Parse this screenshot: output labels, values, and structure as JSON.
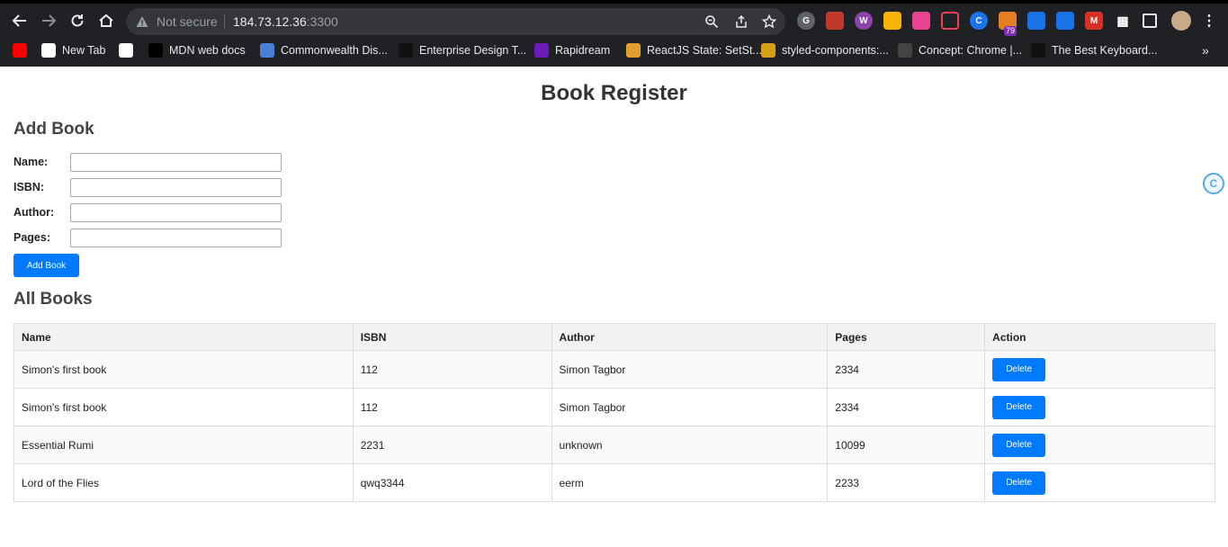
{
  "browser": {
    "security_label": "Not secure",
    "url_host": "184.73.12.36",
    "url_port": ":3300",
    "extension_badge_count": "79",
    "bookmarks": [
      {
        "label": "",
        "icon": "youtube-icon",
        "color": "#ff0000"
      },
      {
        "label": "New Tab",
        "icon": "google-icon",
        "color": "#ffffff"
      },
      {
        "label": "",
        "icon": "globe-icon",
        "color": "#ffffff"
      },
      {
        "label": "MDN web docs",
        "icon": "mdn-icon",
        "color": "#000000"
      },
      {
        "label": "Commonwealth Dis...",
        "icon": "globe-icon",
        "color": "#4a7fd6"
      },
      {
        "label": "Enterprise Design T...",
        "icon": "enterprise-icon",
        "color": "#111111"
      },
      {
        "label": "Rapidream",
        "icon": "rapidream-icon",
        "color": "#6a1bb8"
      },
      {
        "label": "ReactJS State: SetSt...",
        "icon": "react-state-icon",
        "color": "#e0a030"
      },
      {
        "label": "styled-components:...",
        "icon": "styled-components-icon",
        "color": "#d4a017"
      },
      {
        "label": "Concept: Chrome |...",
        "icon": "concept-icon",
        "color": "#444444"
      },
      {
        "label": "The Best Keyboard...",
        "icon": "htg-icon",
        "color": "#111111"
      }
    ]
  },
  "page": {
    "title": "Book Register",
    "add_section_title": "Add Book",
    "list_section_title": "All Books"
  },
  "form": {
    "name_label": "Name:",
    "isbn_label": "ISBN:",
    "author_label": "Author:",
    "pages_label": "Pages:",
    "name_value": "",
    "isbn_value": "",
    "author_value": "",
    "pages_value": "",
    "submit_label": "Add Book"
  },
  "table": {
    "headers": [
      "Name",
      "ISBN",
      "Author",
      "Pages",
      "Action"
    ],
    "delete_label": "Delete",
    "rows": [
      {
        "name": "Simon's first book",
        "isbn": "112",
        "author": "Simon Tagbor",
        "pages": "2334"
      },
      {
        "name": "Simon's first book",
        "isbn": "112",
        "author": "Simon Tagbor",
        "pages": "2334"
      },
      {
        "name": "Essential Rumi",
        "isbn": "2231",
        "author": "unknown",
        "pages": "10099"
      },
      {
        "name": "Lord of the Flies",
        "isbn": "qwq3344",
        "author": "eerm",
        "pages": "2233"
      }
    ]
  },
  "colors": {
    "primary_button": "#007bff",
    "chrome_bg": "#202124"
  }
}
